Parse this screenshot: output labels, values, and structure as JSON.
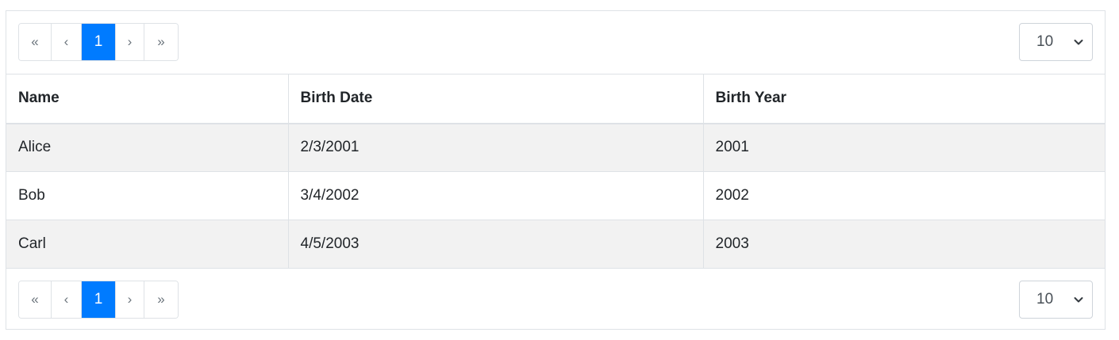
{
  "pagination_top": {
    "first": "«",
    "prev": "‹",
    "current": "1",
    "next": "›",
    "last": "»"
  },
  "pagination_bottom": {
    "first": "«",
    "prev": "‹",
    "current": "1",
    "next": "›",
    "last": "»"
  },
  "page_size_top": {
    "selected": "10"
  },
  "page_size_bottom": {
    "selected": "10"
  },
  "table": {
    "headers": [
      "Name",
      "Birth Date",
      "Birth Year"
    ],
    "rows": [
      [
        "Alice",
        "2/3/2001",
        "2001"
      ],
      [
        "Bob",
        "3/4/2002",
        "2002"
      ],
      [
        "Carl",
        "4/5/2003",
        "2003"
      ]
    ]
  },
  "colors": {
    "accent": "#007bff",
    "striped_row": "#f2f2f2",
    "border": "#dee2e6"
  },
  "icons": {
    "dropdown": "chevron-down-icon"
  }
}
